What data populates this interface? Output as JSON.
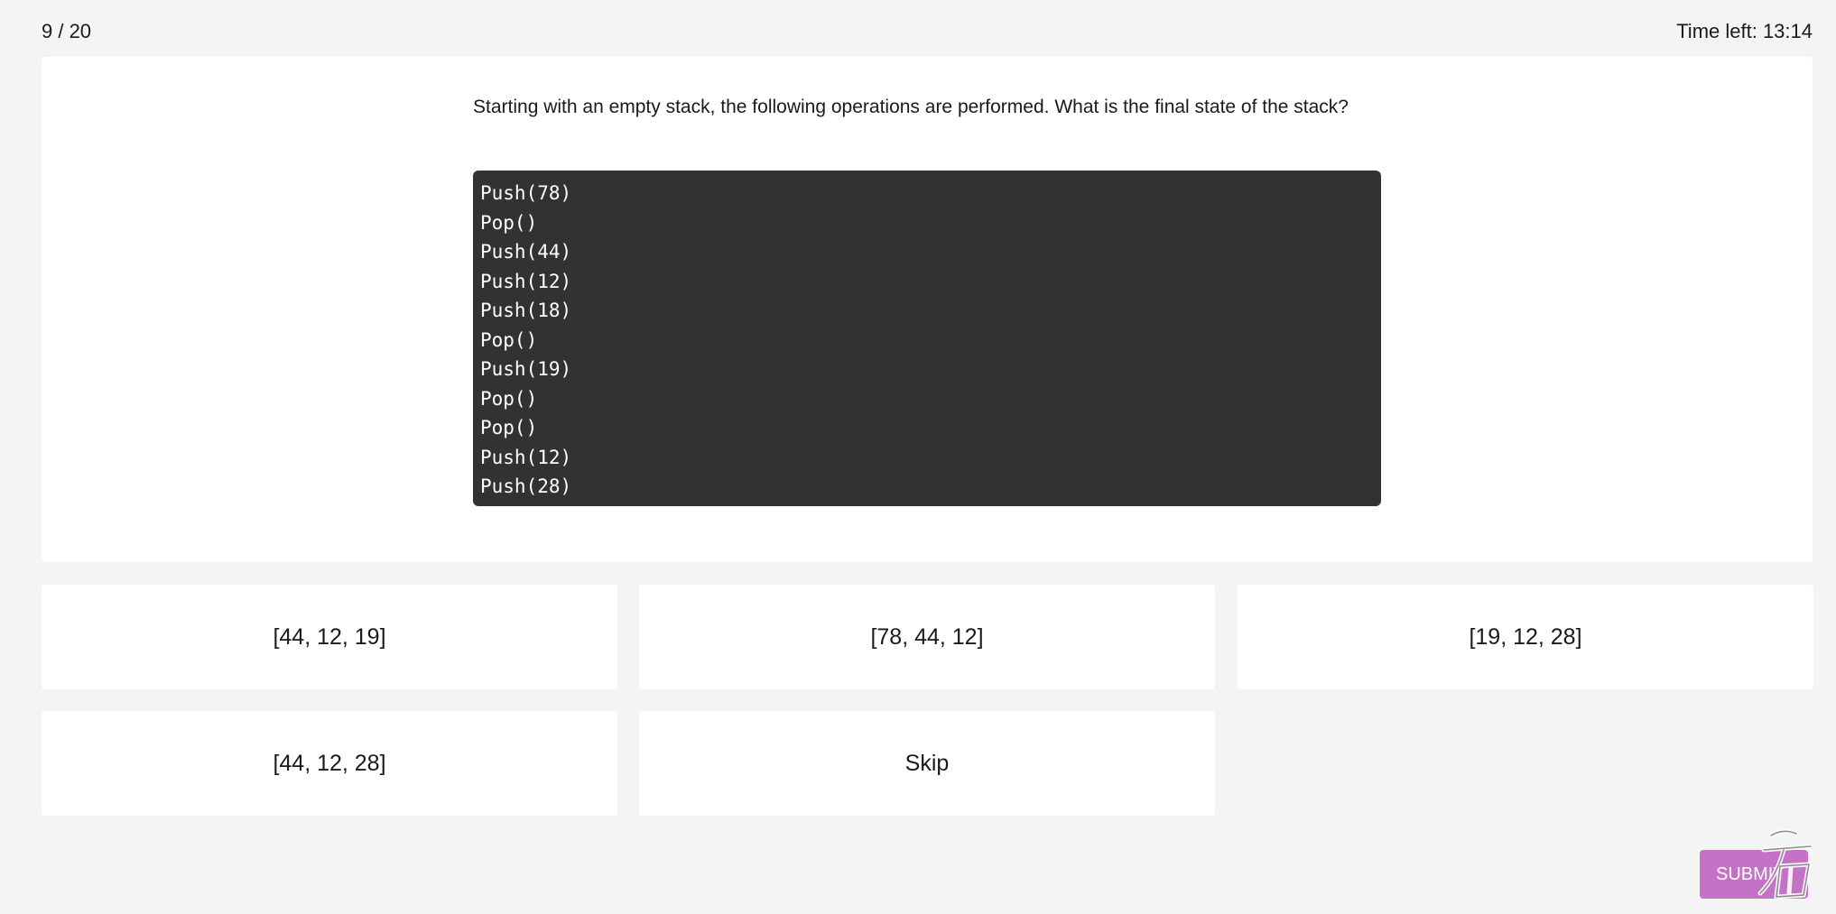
{
  "header": {
    "progress": "9 / 20",
    "timer": "Time left: 13:14"
  },
  "question": {
    "text": "Starting with an empty stack, the following operations are performed. What is the final state of the stack?",
    "code_lines": [
      "Push(78)",
      "Pop()",
      "Push(44)",
      "Push(12)",
      "Push(18)",
      "Pop()",
      "Push(19)",
      "Pop()",
      "Pop()",
      "Push(12)",
      "Push(28)"
    ]
  },
  "options": [
    {
      "label": "[44, 12, 19]"
    },
    {
      "label": "[78, 44, 12]"
    },
    {
      "label": "[19, 12, 28]"
    },
    {
      "label": "[44, 12, 28]"
    },
    {
      "label": "Skip"
    }
  ],
  "footer": {
    "submit_label": "SUBMIT"
  },
  "colors": {
    "background": "#f4f4f4",
    "card": "#ffffff",
    "code_background": "#323232",
    "submit": "#c472c6"
  },
  "icons": {
    "watermark": "watermark-logo"
  }
}
